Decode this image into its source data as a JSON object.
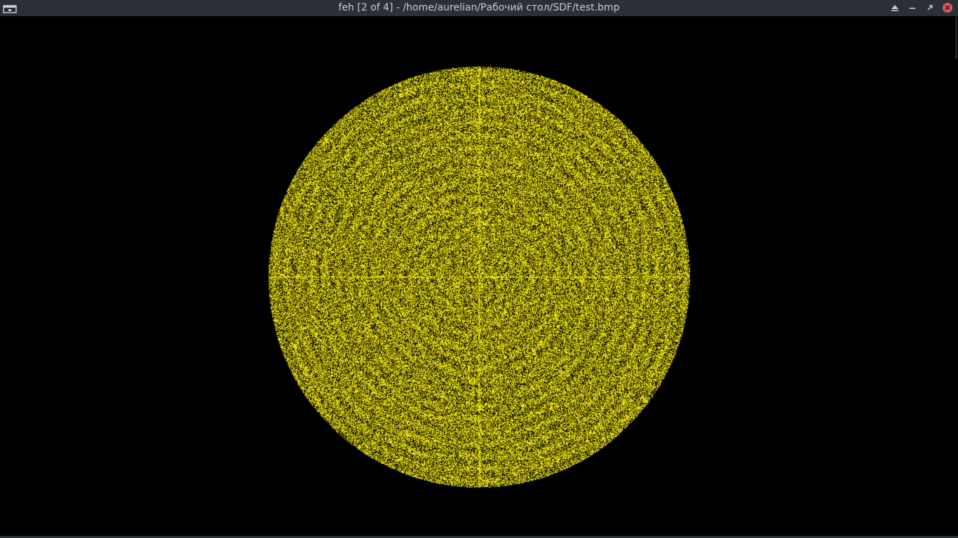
{
  "window": {
    "title": "feh [2 of 4] - /home/aurelian/Рабочий стол/SDF/test.bmp",
    "controls": [
      "window-menu-icon",
      "keep-above-icon",
      "minimize-icon",
      "maximize-icon",
      "close-icon"
    ]
  },
  "image": {
    "file": "test.bmp",
    "colors": {
      "background": "#000000",
      "fill": "#e6dc14",
      "noise_dark": "#1a1a00"
    }
  },
  "colors": {
    "titlebar": "#2b2f36",
    "title_text": "#c8ccd2",
    "close_button": "#e0555e"
  }
}
